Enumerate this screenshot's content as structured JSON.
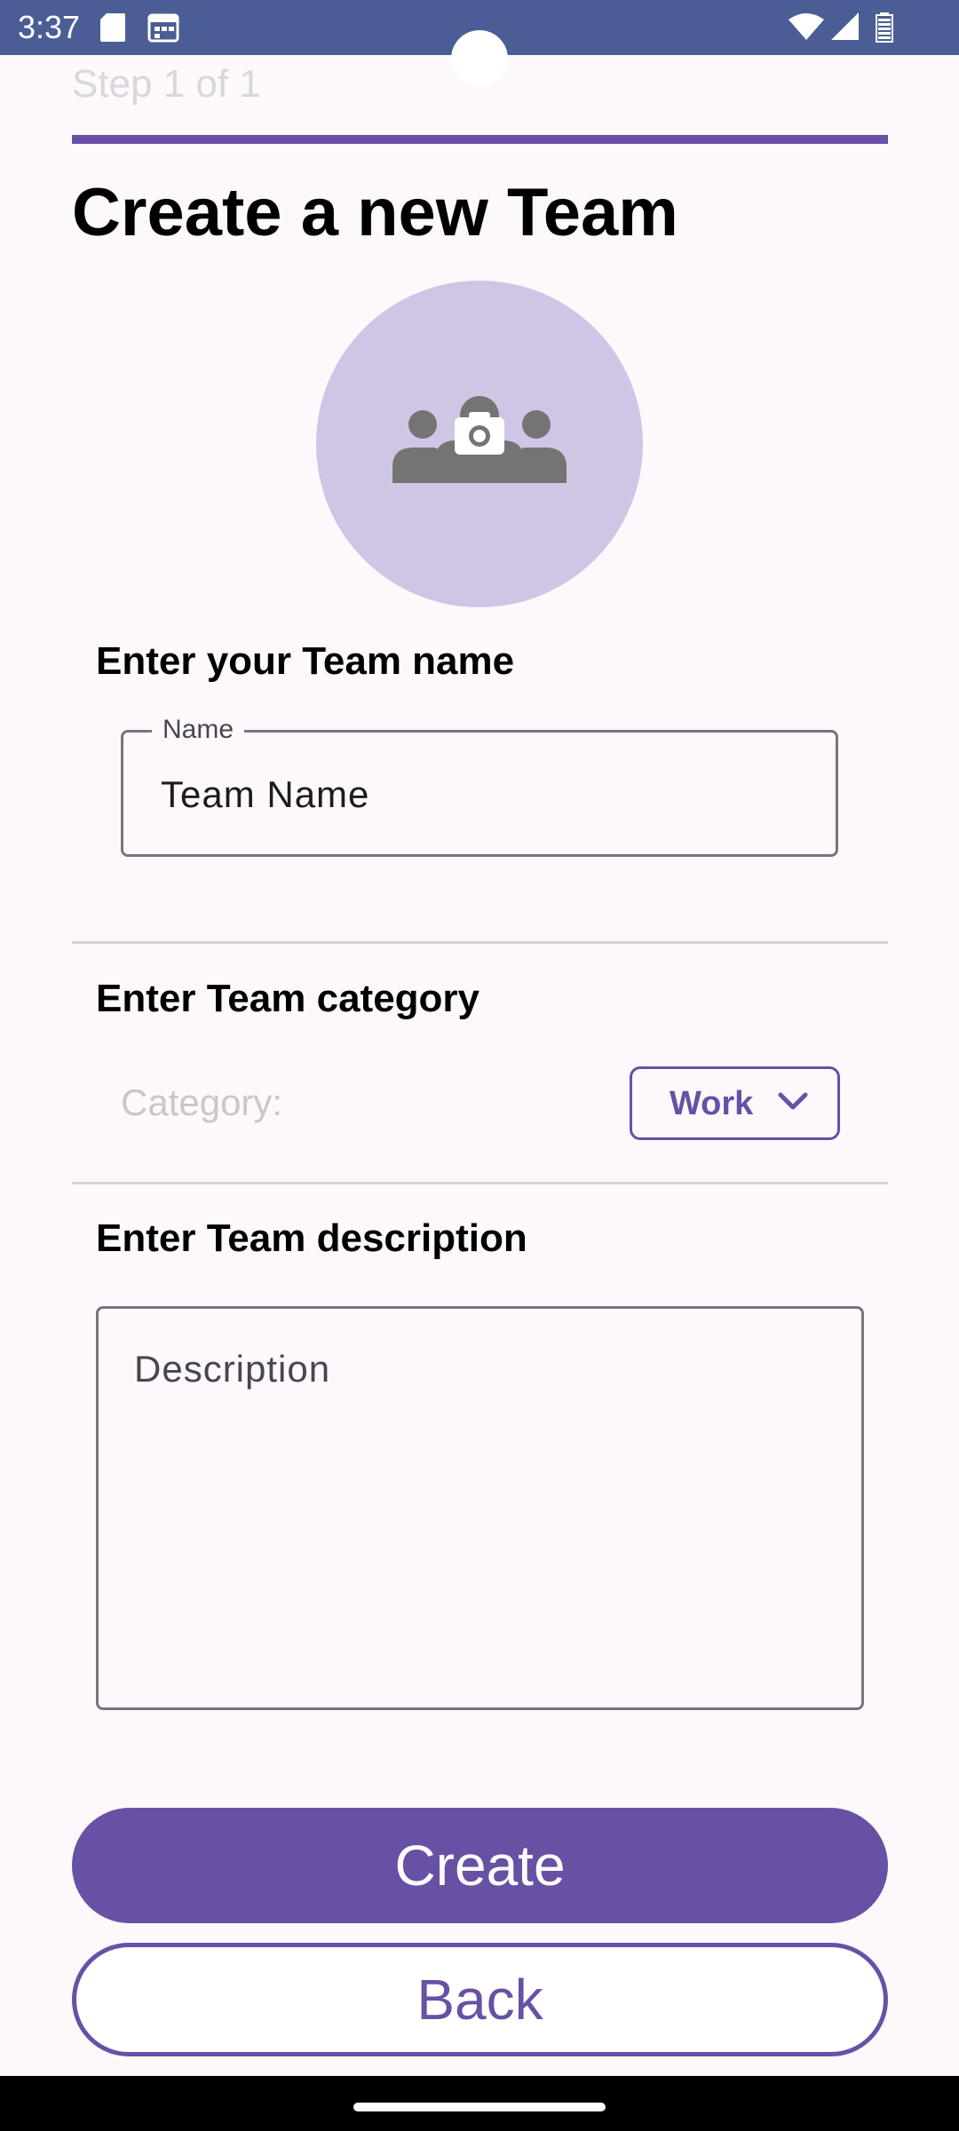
{
  "status_bar": {
    "time": "3:37",
    "icons": [
      "sd-card-icon",
      "calendar-icon",
      "wifi-icon",
      "signal-icon",
      "battery-icon"
    ]
  },
  "step": {
    "text": "Step 1 of 1",
    "progress": 1.0
  },
  "title": "Create a new Team",
  "avatar": {
    "icon": "team-camera-icon"
  },
  "team_name": {
    "section_label": "Enter your Team name",
    "field_label": "Name",
    "value": "Team Name"
  },
  "category": {
    "section_label": "Enter Team category",
    "label": "Category:",
    "selected": "Work"
  },
  "description": {
    "section_label": "Enter Team description",
    "placeholder": "Description"
  },
  "buttons": {
    "create": "Create",
    "back": "Back"
  },
  "colors": {
    "accent": "#6850a4",
    "status_bar": "#4a5d95",
    "avatar_bg": "#d1c5e5",
    "background": "#fdf8fb"
  }
}
